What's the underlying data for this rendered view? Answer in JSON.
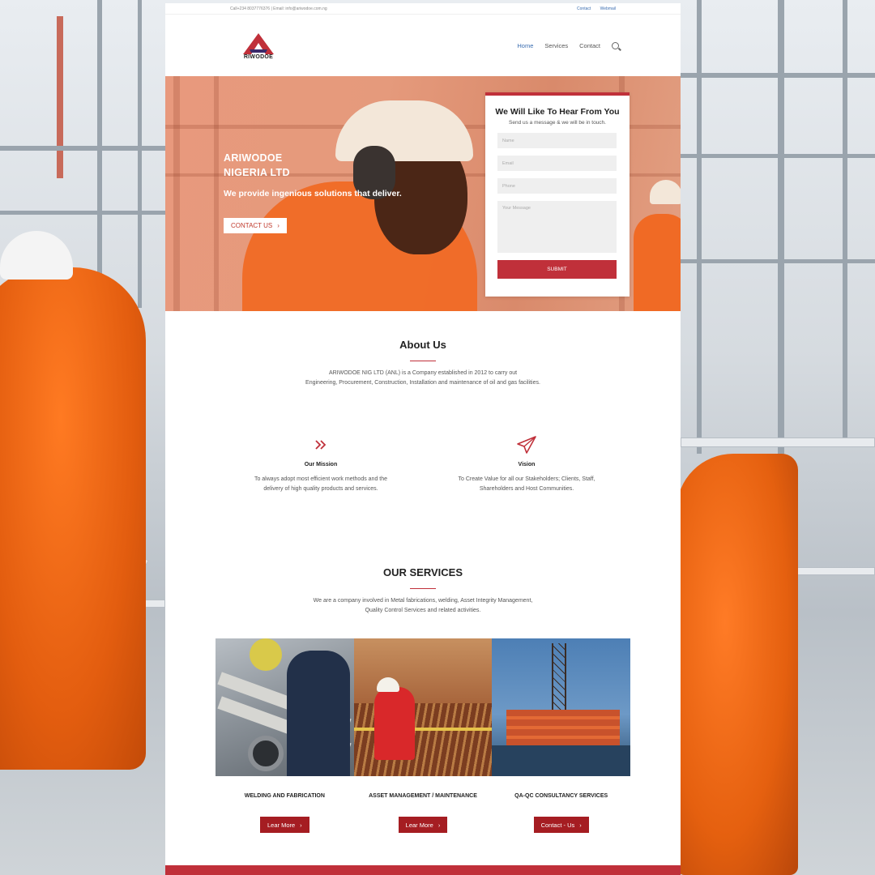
{
  "topbar": {
    "contact_info": "Call+234 8037776376 | Email: info@ariwodoe.com.ng",
    "links": [
      "Contact",
      "Webmail"
    ]
  },
  "logo": {
    "wordmark": "RIWODOE"
  },
  "nav": {
    "items": [
      "Home",
      "Services",
      "Contact"
    ],
    "active": "Home"
  },
  "hero": {
    "company_line1": "ARIWODOE",
    "company_line2": "NIGERIA LTD",
    "tagline": "We provide ingenious solutions that deliver.",
    "cta_label": "CONTACT US"
  },
  "contact_form": {
    "title": "We Will Like To Hear From You",
    "subtitle": "Send us a message & we will be in touch.",
    "name_placeholder": "Name",
    "email_placeholder": "Email",
    "phone_placeholder": "Phone",
    "message_placeholder": "Your Message",
    "submit_label": "SUBMIT"
  },
  "about": {
    "title": "About Us",
    "line1": "ARIWODOE NIG LTD (ANL) is a Company established in 2012 to carry out",
    "line2": "Engineering, Procurement, Construction, Installation and maintenance of oil and gas facilities."
  },
  "mission": {
    "title": "Our Mission",
    "line1": "To always adopt most efficient work methods and the",
    "line2": "delivery of high quality products and services.",
    "icon": "chevrons-right-icon"
  },
  "vision": {
    "title": "Vision",
    "line1": "To Create Value for all our Stakeholders; Clients, Staff,",
    "line2": "Shareholders and Host Communities.",
    "icon": "paper-plane-icon"
  },
  "services": {
    "title": "OUR SERVICES",
    "line1": "We are a company involved in Metal fabrications, welding, Asset Integrity Management,",
    "line2": "Quality Control Services and related activities.",
    "cards": [
      {
        "label": "WELDING AND FABRICATION",
        "button": "Lear More"
      },
      {
        "label": "ASSET MANAGEMENT / MAINTENANCE",
        "button": "Lear More"
      },
      {
        "label": "QA-QC CONSULTANCY SERVICES",
        "button": "Contact - Us"
      }
    ]
  },
  "colors": {
    "brand_red": "#c0303a",
    "button_dark_red": "#a51d22",
    "link_blue": "#3a6db0",
    "hero_tint": "#e59a7c"
  }
}
